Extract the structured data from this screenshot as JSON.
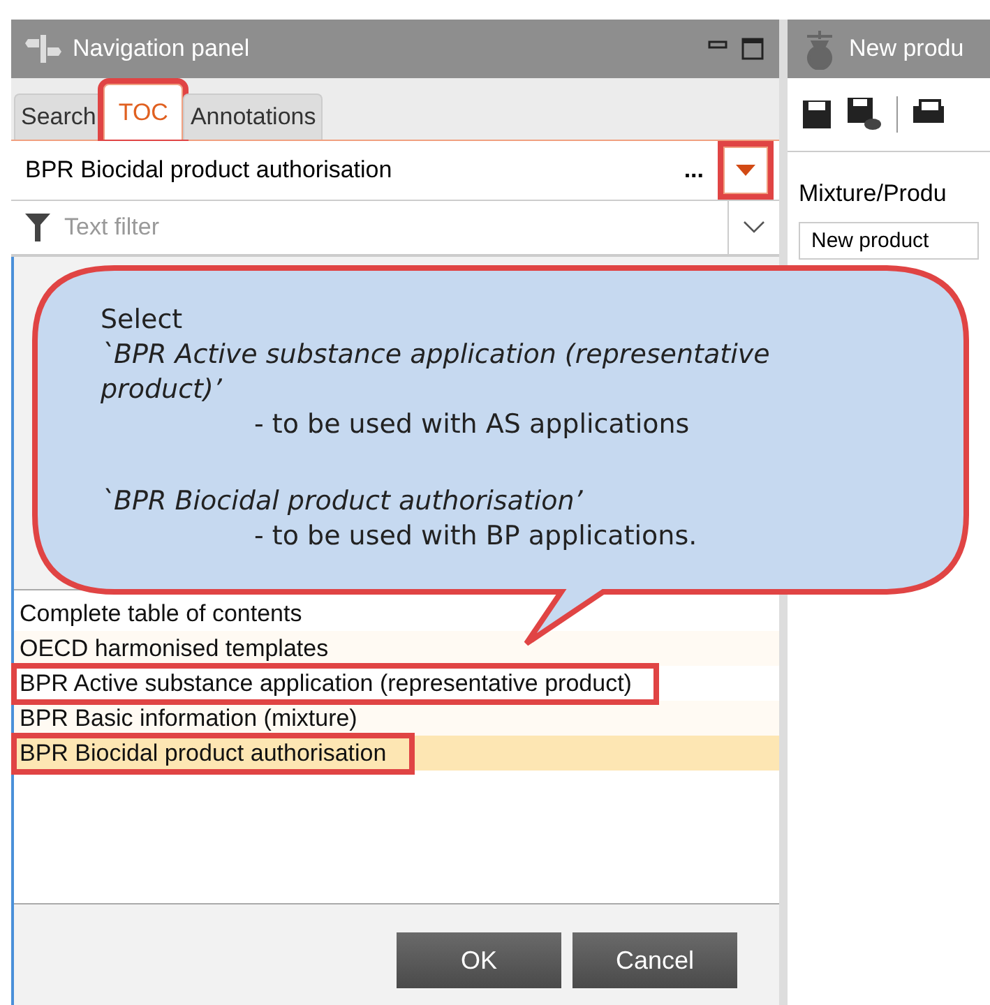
{
  "navigation_panel": {
    "title": "Navigation panel",
    "tabs": [
      {
        "label": "Search",
        "selected": false,
        "highlighted": false
      },
      {
        "label": "TOC",
        "selected": true,
        "highlighted": true
      },
      {
        "label": "Annotations",
        "selected": false,
        "highlighted": false
      }
    ],
    "toc_selector": {
      "value": "BPR Biocidal product authorisation",
      "more": "...",
      "dropdown_highlighted": true
    },
    "filter": {
      "placeholder": "Text filter"
    }
  },
  "dialog": {
    "items": [
      {
        "label": "Complete table of contents",
        "selected": false,
        "highlighted": false
      },
      {
        "label": "OECD harmonised templates",
        "selected": false,
        "highlighted": false
      },
      {
        "label": "BPR Active substance application (representative product)",
        "selected": false,
        "highlighted": true
      },
      {
        "label": "BPR Basic information (mixture)",
        "selected": false,
        "highlighted": false
      },
      {
        "label": "BPR Biocidal product authorisation",
        "selected": true,
        "highlighted": true
      }
    ],
    "buttons": [
      "OK",
      "Cancel"
    ]
  },
  "editor_panel": {
    "title": "New produ",
    "field_label": "Mixture/Produ",
    "field_value": "New product"
  },
  "callout": {
    "paragraphs": [
      [
        {
          "kind": "plain",
          "text": "Select"
        },
        {
          "kind": "italic",
          "text": "`BPR Active substance application (representative product)’"
        },
        {
          "kind": "indent",
          "text": "- to be used with AS applications"
        }
      ],
      [
        {
          "kind": "italic",
          "text": "`BPR Biocidal product authorisation’"
        },
        {
          "kind": "indent",
          "text": "- to be used with BP applications."
        }
      ]
    ]
  }
}
